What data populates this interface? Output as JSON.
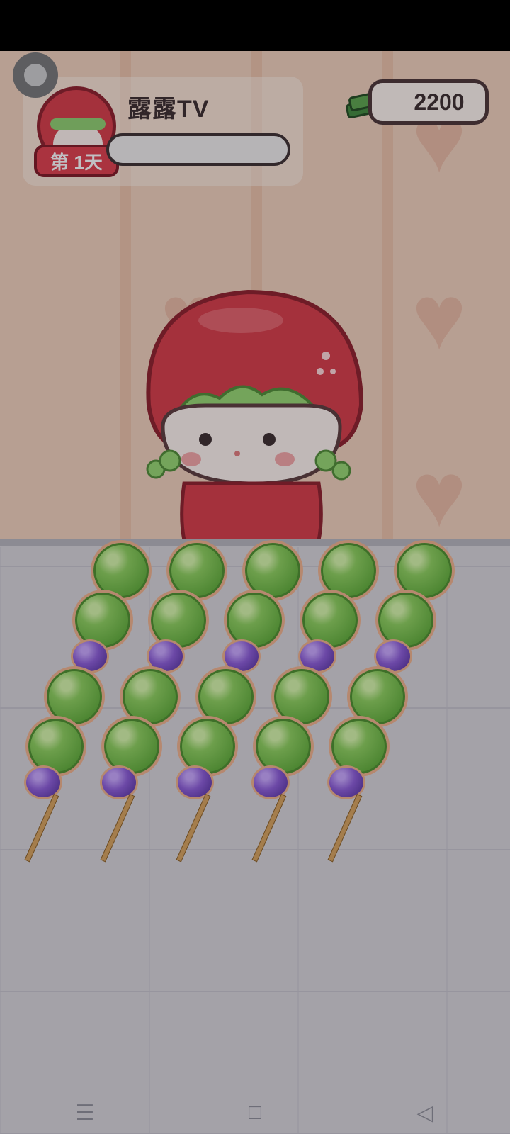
{
  "player": {
    "name": "露露TV",
    "day_label": "第 1天"
  },
  "wallet": {
    "amount": "2200"
  },
  "colors": {
    "accent_red": "#d83a45",
    "skewer_green": "#6fc043",
    "skewer_purple": "#7a48c8",
    "money_green": "#5aa64a"
  },
  "icons": {
    "settings": "gear-icon",
    "money": "cash-stack-icon",
    "nav_menu": "menu-icon",
    "nav_home": "home-icon",
    "nav_back": "back-icon"
  },
  "nav": {
    "menu_glyph": "☰",
    "home_glyph": "□",
    "back_glyph": "◁"
  },
  "skewers": {
    "count": 5,
    "composition": [
      "green",
      "green",
      "green",
      "green",
      "purple",
      "purple"
    ]
  }
}
